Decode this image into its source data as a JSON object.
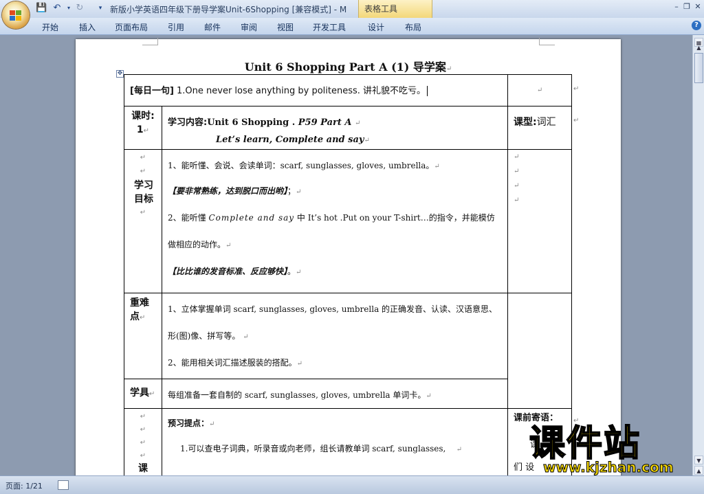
{
  "window": {
    "title": "新版小学英语四年级下册导学案Unit-6Shopping [兼容模式] - M",
    "contextual_tab": "表格工具"
  },
  "ribbon": {
    "tabs": [
      "开始",
      "插入",
      "页面布局",
      "引用",
      "邮件",
      "审阅",
      "视图",
      "开发工具",
      "设计",
      "布局"
    ]
  },
  "document": {
    "title": "Unit 6 Shopping    Part A (1)  导学案",
    "paragraph_mark": "↵",
    "row_daily": {
      "label": "[每日一句]",
      "text": " 1.One never lose anything by politeness. 讲礼貌不吃亏。"
    },
    "row_lesson": {
      "label_line1": "课时:",
      "label_line2": "1",
      "content_label": "学习内容:",
      "content_unit": "Unit 6 Shopping . ",
      "content_page": "P59 Part A",
      "line2": "Let’s learn, Complete and say",
      "type_label": "课型:",
      "type_value": "词汇"
    },
    "row_goals": {
      "label": "学习目标",
      "line1": "1、能听懂、会说、会读单词：scarf, sunglasses, gloves, umbrella。",
      "line2_bold": "【要非常熟练，达到脱口而出哟】",
      "line2_tail": "；",
      "line3_a": "2、能听懂 ",
      "line3_it": "Complete and say",
      "line3_b": " 中 It’s hot .Put on your T-shirt…的指令，并能模仿",
      "line4": "做相应的动作。",
      "line5_bold": "【比比谁的发音标准、反应够快】",
      "line5_tail": "。"
    },
    "row_key": {
      "label_line1": "重难",
      "label_line2": "点",
      "line1": "1、立体掌握单词 scarf, sunglasses, gloves, umbrella 的正确发音、认读、汉语意思、",
      "line2": "形(图)像、拼写等。",
      "line3": "2、能用相关词汇描述服装的搭配。"
    },
    "row_tools": {
      "label": "学具",
      "text": "每组准备一套自制的 scarf, sunglasses, gloves, umbrella 单词卡。"
    },
    "row_preview": {
      "label_partial": "课",
      "heading": "预习提点：",
      "line1": "1.可以查电子词典，听录音或向老师，组长请教单词 scarf, sunglasses,",
      "right_heading": "课前寄语：",
      "right_line1": "课",
      "right_line2": "们 设"
    }
  },
  "statusbar": {
    "page": "页面: 1/21"
  },
  "watermark": {
    "text": "课件站",
    "url": "www.kjzhan.com"
  }
}
